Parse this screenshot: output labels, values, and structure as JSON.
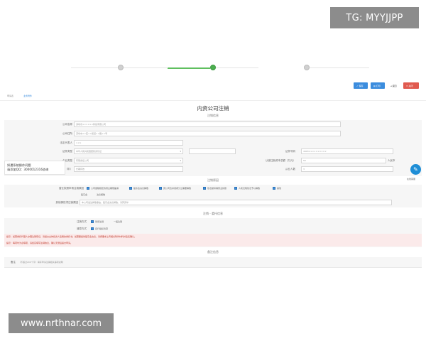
{
  "watermarks": {
    "top": "TG: MYYJJPP",
    "bottom": "www.nrthnar.com"
  },
  "colors": {
    "accent": "#3c8dde",
    "success": "#4caf50",
    "danger": "#e05a4f"
  },
  "toolbar": {
    "save": "保存",
    "print": "打印",
    "back": "返回",
    "close": "关闭"
  },
  "tabs": [
    "申请表",
    "业务附件"
  ],
  "form": {
    "title": "内资公司注销",
    "sections": {
      "basic": "注销信息",
      "reason": "注销原因",
      "items": "注销 - 委托信息",
      "remarks": "备注信息"
    },
    "fields": {
      "company_name": {
        "label": "公司名称",
        "value": "深圳市××××××科技有限公司"
      },
      "address": {
        "label": "公司住所",
        "value": "深圳市××区××街道××路××号"
      },
      "legal_rep": {
        "label": "法定代表人",
        "value": "×××"
      },
      "id_type": {
        "label": "证件类型",
        "value": "中华人民共和国居民身份证"
      },
      "id_no": {
        "label": "证件号码",
        "value": "4403××××××××××"
      },
      "company_type": {
        "label": "企业类型",
        "value": "有限责任公司"
      },
      "capital": {
        "label": "认缴注册资本总额（万元）",
        "value": "50",
        "unit": "人民币"
      },
      "reg_no": {
        "label": "营业期限（年）",
        "value": "长期有效"
      },
      "employees": {
        "label": "从业人数",
        "value": "3"
      },
      "reason_label": "营业执照申请注销原因",
      "other_reason_label": "其他情形须注销原因",
      "other_reason_value": "本公司发生解散事由，股东会决议解散，清算完毕",
      "receipt_label": "注销方式",
      "method_label": "清算方式"
    },
    "reasons": [
      "公司章程规定的营业期限届满",
      "股东会决议解散",
      "因公司合并或者分立需要解散",
      "依法被吊销营业执照",
      "人民法院依法予以解散",
      "其他"
    ],
    "reason_extra": [
      "股东会",
      "决议解散"
    ],
    "receipt_options": [
      "简易注销",
      "一般注销"
    ],
    "method_options": [
      "自行组织清算"
    ],
    "warnings": [
      "提示：如需委托代理人办理注销登记，请提交全体投资人签署的委托书；如需要提供股东会决议，请按要求上传相关附件材料并签名确认。",
      "提示：每项均为必填项，请如实填写注销信息，确认无误后提交申请。"
    ],
    "remarks_label": "备注",
    "remarks_value": "（不超过200个字）填写申请注销相关事项说明"
  },
  "side_card": {
    "line1": "如遇系统操作问题",
    "line2": "请添加QQ：3000012316咨询"
  },
  "fab": {
    "icon": "chat-icon",
    "label": "在线客服"
  }
}
